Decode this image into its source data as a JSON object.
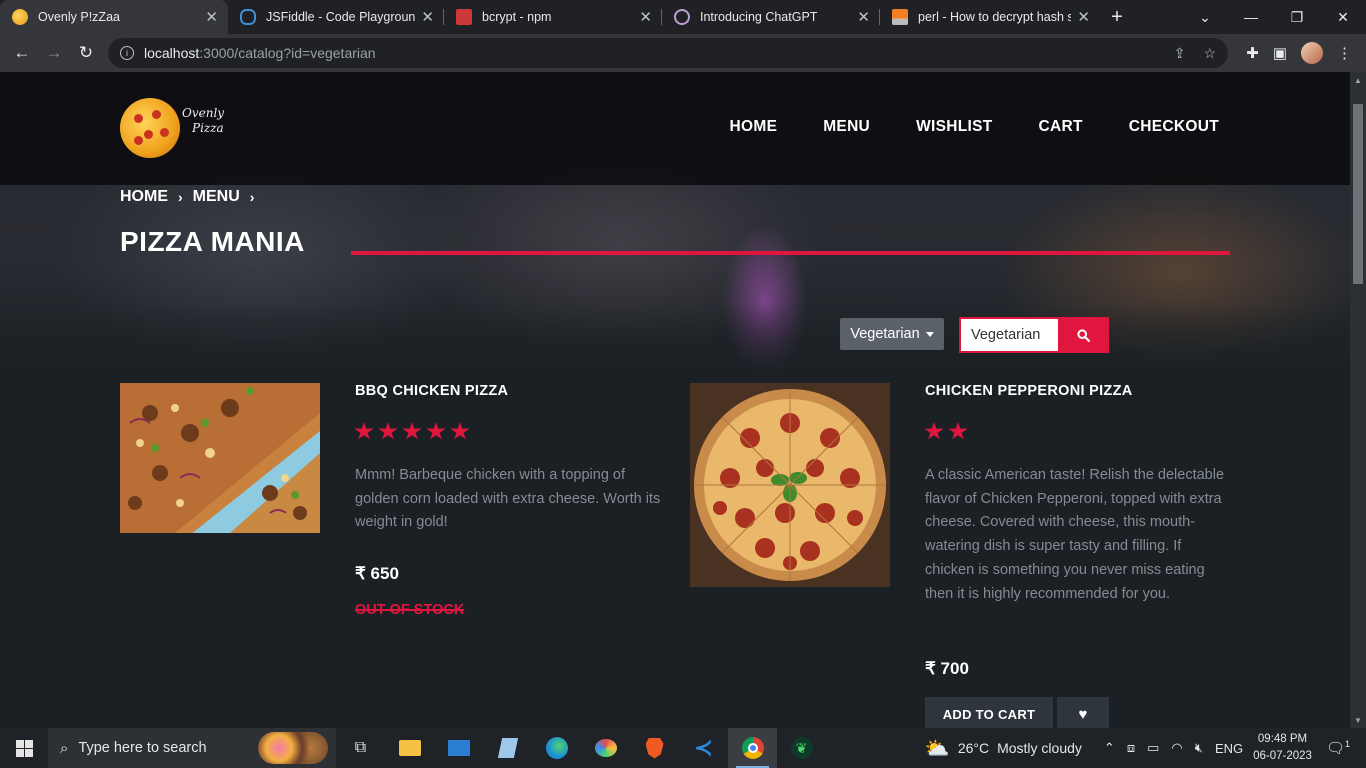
{
  "browser": {
    "tabs": [
      {
        "title": "Ovenly P!zZaa",
        "active": true,
        "icon": "pizza-favicon"
      },
      {
        "title": "JSFiddle - Code Playground",
        "active": false,
        "icon": "jsfiddle-favicon"
      },
      {
        "title": "bcrypt - npm",
        "active": false,
        "icon": "npm-favicon"
      },
      {
        "title": "Introducing ChatGPT",
        "active": false,
        "icon": "openai-favicon"
      },
      {
        "title": "perl - How to decrypt hash st",
        "active": false,
        "icon": "stackoverflow-favicon"
      }
    ],
    "url_host": "localhost",
    "url_rest": ":3000/catalog?id=vegetarian"
  },
  "site": {
    "logo_text_1": "Ovenly",
    "logo_text_2": "Pizza",
    "nav": [
      "HOME",
      "MENU",
      "WISHLIST",
      "CART",
      "CHECKOUT"
    ],
    "breadcrumb": [
      "HOME",
      "MENU"
    ],
    "page_title": "PIZZA MANIA",
    "filter_label": "Vegetarian",
    "search_value": "Vegetarian"
  },
  "products": [
    {
      "name": "BBQ CHICKEN PIZZA",
      "rating": 5,
      "description": "Mmm! Barbeque chicken with a topping of golden corn loaded with extra cheese. Worth its weight in gold!",
      "price": "₹ 650",
      "stock_status": "OUT OF STOCK"
    },
    {
      "name": "CHICKEN PEPPERONI PIZZA",
      "rating": 2,
      "description": "A classic American taste! Relish the delectable flavor of Chicken Pepperoni, topped with extra cheese. Covered with cheese, this mouth-watering dish is super tasty and filling. If chicken is something you never miss eating then it is highly recommended for you.",
      "price": "₹ 700",
      "add_to_cart_label": "ADD TO CART"
    }
  ],
  "taskbar": {
    "search_placeholder": "Type here to search",
    "weather_temp": "26°C",
    "weather_text": "Mostly cloudy",
    "language": "ENG",
    "time": "09:48 PM",
    "date": "06-07-2023",
    "notification_count": "1"
  },
  "colors": {
    "accent": "#e0163f",
    "chrome_dark": "#202124",
    "page_bg": "#1b2024"
  }
}
